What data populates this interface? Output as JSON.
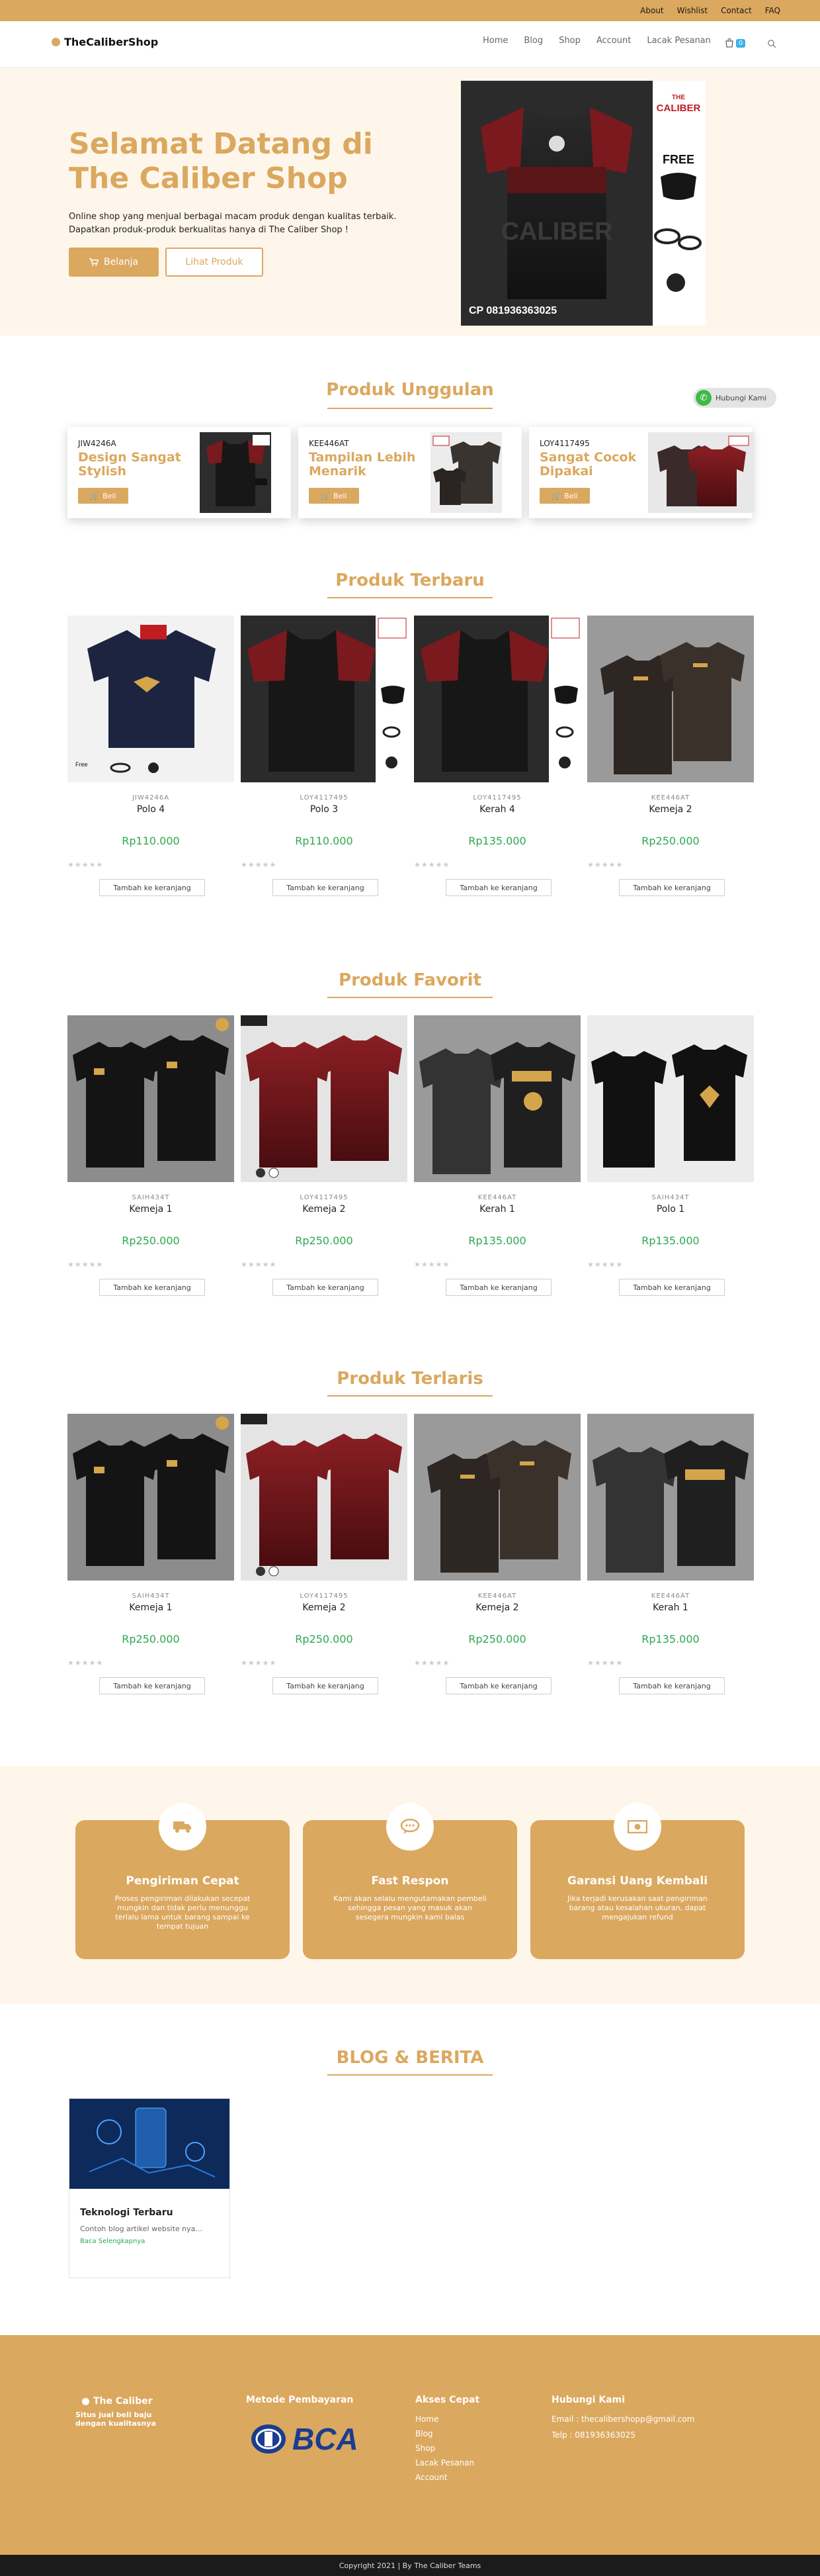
{
  "topbar": {
    "links": [
      "About",
      "Wishlist",
      "Contact",
      "FAQ"
    ]
  },
  "header": {
    "logo": "TheCaliberShop",
    "nav": [
      "Home",
      "Blog",
      "Shop",
      "Account",
      "Lacak Pesanan"
    ],
    "cart_count": "0"
  },
  "hero": {
    "title": "Selamat Datang di The Caliber Shop",
    "subtitle": "Online shop yang menjual berbagai macam produk dengan kualitas terbaik. Dapatkan produk-produk berkualitas hanya di The Caliber Shop !",
    "btn_shop": "Belanja",
    "btn_view": "Lihat Produk",
    "image_text": "CP 081936363025",
    "image_logo": "THE CALIBER",
    "image_free": "FREE"
  },
  "whatsapp": {
    "label": "Hubungi Kami"
  },
  "featured": {
    "title": "Produk Unggulan",
    "items": [
      {
        "sku": "JIW4246A",
        "name": "Design Sangat Stylish",
        "btn": "Beli"
      },
      {
        "sku": "KEE446AT",
        "name": "Tampilan Lebih Menarik",
        "btn": "Beli"
      },
      {
        "sku": "LOY4117495",
        "name": "Sangat Cocok Dipakai",
        "btn": "Beli"
      }
    ]
  },
  "terbaru": {
    "title": "Produk Terbaru",
    "items": [
      {
        "sku": "JIW4246A",
        "name": "Polo 4",
        "price": "Rp110.000",
        "btn": "Tambah ke keranjang",
        "stars": "★★★★★"
      },
      {
        "sku": "LOY4117495",
        "name": "Polo 3",
        "price": "Rp110.000",
        "btn": "Tambah ke keranjang",
        "stars": "★★★★★"
      },
      {
        "sku": "LOY4117495",
        "name": "Kerah 4",
        "price": "Rp135.000",
        "btn": "Tambah ke keranjang",
        "stars": "★★★★★"
      },
      {
        "sku": "KEE446AT",
        "name": "Kemeja 2",
        "price": "Rp250.000",
        "btn": "Tambah ke keranjang",
        "stars": "★★★★★"
      }
    ]
  },
  "favorit": {
    "title": "Produk Favorit",
    "items": [
      {
        "sku": "SAIH434T",
        "name": "Kemeja 1",
        "price": "Rp250.000",
        "btn": "Tambah ke keranjang",
        "stars": "★★★★★"
      },
      {
        "sku": "LOY4117495",
        "name": "Kemeja 2",
        "price": "Rp250.000",
        "btn": "Tambah ke keranjang",
        "stars": "★★★★★"
      },
      {
        "sku": "KEE446AT",
        "name": "Kerah 1",
        "price": "Rp135.000",
        "btn": "Tambah ke keranjang",
        "stars": "★★★★★"
      },
      {
        "sku": "SAIH434T",
        "name": "Polo 1",
        "price": "Rp135.000",
        "btn": "Tambah ke keranjang",
        "stars": "★★★★★"
      }
    ]
  },
  "terlaris": {
    "title": "Produk Terlaris",
    "items": [
      {
        "sku": "SAIH434T",
        "name": "Kemeja 1",
        "price": "Rp250.000",
        "btn": "Tambah ke keranjang",
        "stars": "★★★★★"
      },
      {
        "sku": "LOY4117495",
        "name": "Kemeja 2",
        "price": "Rp250.000",
        "btn": "Tambah ke keranjang",
        "stars": "★★★★★"
      },
      {
        "sku": "KEE446AT",
        "name": "Kemeja 2",
        "price": "Rp250.000",
        "btn": "Tambah ke keranjang",
        "stars": "★★★★★"
      },
      {
        "sku": "KEE446AT",
        "name": "Kerah 1",
        "price": "Rp135.000",
        "btn": "Tambah ke keranjang",
        "stars": "★★★★★"
      }
    ]
  },
  "features": [
    {
      "title": "Pengiriman Cepat",
      "desc": "Proses pengiriman dilakukan secepat mungkin dan tidak perlu menunggu terlalu lama untuk barang sampai ke tempat tujuan",
      "icon": "truck-icon"
    },
    {
      "title": "Fast Respon",
      "desc": "Kami akan selalu mengutamakan pembeli sehingga pesan yang masuk akan sesegera mungkin kami balas",
      "icon": "chat-icon"
    },
    {
      "title": "Garansi Uang Kembali",
      "desc": "Jika terjadi kerusakan saat pengiriman barang atau kesalahan ukuran, dapat mengajukan refund",
      "icon": "money-icon"
    }
  ],
  "blog": {
    "title": "BLOG & BERITA",
    "post": {
      "title": "Teknologi Terbaru",
      "desc": "Contoh blog artikel website nya...",
      "more": "Baca Selengkapnya"
    }
  },
  "footer": {
    "brand": "The Caliber",
    "tagline": "Situs jual beli baju dengan kualitasnya",
    "payment_title": "Metode Pembayaran",
    "payment_brand": "BCA",
    "links_title": "Akses Cepat",
    "links": [
      "Home",
      "Blog",
      "Shop",
      "Lacak Pesanan",
      "Account"
    ],
    "contact_title": "Hubungi Kami",
    "email": "Email : thecalibershopp@gmail.com",
    "phone": "Telp : 081936363025"
  },
  "copyright": "Copyright 2021 | By The Caliber Teams",
  "colors": {
    "accent": "#dba85f",
    "cream": "#fef6ea",
    "price": "#2fa84f",
    "maroon": "#6e1a1d",
    "dark": "#1e1e1e"
  }
}
